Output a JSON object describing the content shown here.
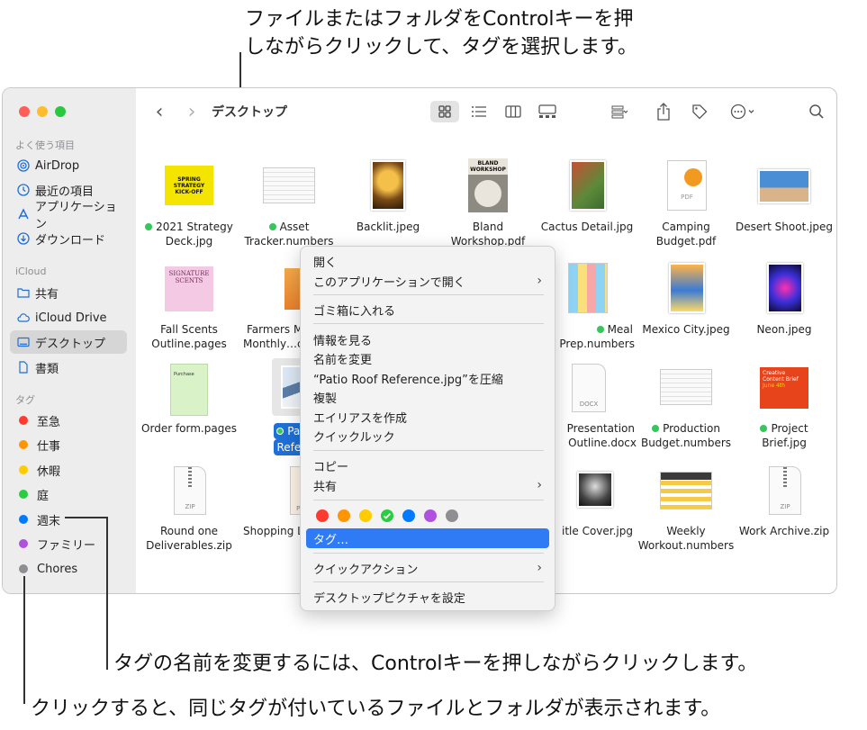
{
  "callouts": {
    "top_line1": "ファイルまたはフォルダをControlキーを押",
    "top_line2": "しながらクリックして、タグを選択します。",
    "rename": "タグの名前を変更するには、Controlキーを押しながらクリックします。",
    "click": "クリックすると、同じタグが付いているファイルとフォルダが表示されます。"
  },
  "sidebar": {
    "favorites_header": "よく使う項目",
    "favorites": [
      {
        "label": "AirDrop",
        "icon": "airdrop-icon"
      },
      {
        "label": "最近の項目",
        "icon": "clock-icon"
      },
      {
        "label": "アプリケーション",
        "icon": "applications-icon"
      },
      {
        "label": "ダウンロード",
        "icon": "download-icon"
      }
    ],
    "icloud_header": "iCloud",
    "icloud": [
      {
        "label": "共有",
        "icon": "shared-folder-icon"
      },
      {
        "label": "iCloud Drive",
        "icon": "cloud-icon"
      },
      {
        "label": "デスクトップ",
        "icon": "desktop-icon"
      },
      {
        "label": "書類",
        "icon": "document-icon"
      }
    ],
    "tags_header": "タグ",
    "tags": [
      {
        "label": "至急",
        "color": "#ff3b30"
      },
      {
        "label": "仕事",
        "color": "#ff9500"
      },
      {
        "label": "休暇",
        "color": "#ffcc00"
      },
      {
        "label": "庭",
        "color": "#28cd41"
      },
      {
        "label": "週末",
        "color": "#007aff"
      },
      {
        "label": "ファミリー",
        "color": "#af52de"
      },
      {
        "label": "Chores",
        "color": "#8e8e93"
      }
    ]
  },
  "toolbar": {
    "title": "デスクトップ",
    "back": "‹",
    "forward": "›"
  },
  "files": [
    {
      "line1": "2021 Strategy",
      "line2": "Deck.jpg",
      "tag": true
    },
    {
      "line1": "Asset",
      "line2": "Tracker.numbers",
      "tag": true
    },
    {
      "line1": "Backlit.jpeg",
      "line2": ""
    },
    {
      "line1": "Bland",
      "line2": "Workshop.pdf"
    },
    {
      "line1": "Cactus Detail.jpg",
      "line2": ""
    },
    {
      "line1": "Camping",
      "line2": "Budget.pdf"
    },
    {
      "line1": "Desert Shoot.jpeg",
      "line2": ""
    },
    {
      "line1": "Fall Scents",
      "line2": "Outline.pages"
    },
    {
      "line1": "Farmers M",
      "line2": "Monthly…ck"
    },
    {
      "line1": "Meal",
      "line2": "Prep.numbers",
      "tag": true
    },
    {
      "line1": "Mexico City.jpeg",
      "line2": ""
    },
    {
      "line1": "Neon.jpeg",
      "line2": ""
    },
    {
      "line1": "Order form.pages",
      "line2": ""
    },
    {
      "line1": "Patio R",
      "line2": "Referenc",
      "tag": true,
      "selected": true
    },
    {
      "line1": "Presentation",
      "line2": "Outline.docx"
    },
    {
      "line1": "Production",
      "line2": "Budget.numbers",
      "tag": true
    },
    {
      "line1": "Project",
      "line2": "Brief.jpg",
      "tag": true
    },
    {
      "line1": "Round one",
      "line2": "Deliverables.zip"
    },
    {
      "line1": "Shopping L",
      "line2": ""
    },
    {
      "line1": "itle Cover.jpg",
      "line2": ""
    },
    {
      "line1": "Weekly",
      "line2": "Workout.numbers"
    },
    {
      "line1": "Work Archive.zip",
      "line2": ""
    }
  ],
  "thumb_labels": {
    "strategy": "SPRING STRATEGY KICK-OFF",
    "bland": "BLAND WORKSHOP",
    "signature": "SIGNATURE SCENTS",
    "pdf": "PDF",
    "docx": "DOCX",
    "zip": "ZIP",
    "brief": "Creative Content Brief",
    "brief_date": "June 4th",
    "order": "Purchase"
  },
  "context_menu": {
    "open": "開く",
    "open_with": "このアプリケーションで開く",
    "trash": "ゴミ箱に入れる",
    "get_info": "情報を見る",
    "rename": "名前を変更",
    "compress": "“Patio Roof Reference.jpg”を圧縮",
    "duplicate": "複製",
    "make_alias": "エイリアスを作成",
    "quick_look": "クイックルック",
    "copy": "コピー",
    "share": "共有",
    "tags": "タグ…",
    "quick_actions": "クイックアクション",
    "set_desktop": "デスクトップピクチャを設定",
    "submenu_arrow": "›",
    "tag_colors": [
      "#ff3b30",
      "#ff9500",
      "#ffcc00",
      "#28cd41",
      "#007aff",
      "#af52de",
      "#8e8e93"
    ],
    "checked_tag": "#28cd41"
  }
}
